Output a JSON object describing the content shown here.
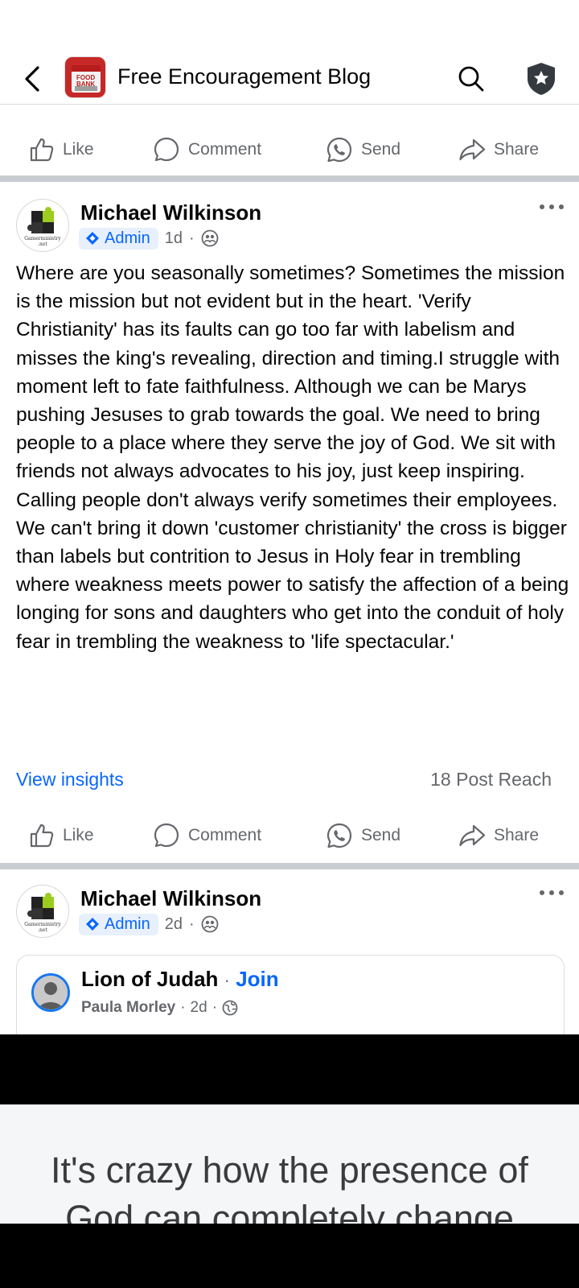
{
  "header": {
    "title": "Free Encouragement Blog",
    "thumb_text_top": "FOOD",
    "thumb_text_bottom": "BANK"
  },
  "actions": {
    "like": "Like",
    "comment": "Comment",
    "send": "Send",
    "share": "Share"
  },
  "post1": {
    "author": "Michael Wilkinson",
    "role": "Admin",
    "time": "1d",
    "avatar_caption_1": "Gamerministry",
    "avatar_caption_2": ".net",
    "body": "Where are you seasonally sometimes? Sometimes the mission is the mission but not evident but in the heart. 'Verify Christianity' has its faults can go too far with labelism and misses the king's revealing, direction and timing.I struggle with moment left to fate faithfulness. Although we can be Marys pushing Jesuses to grab towards the goal. We need to bring people to a place where they serve the joy of God. We sit with friends not always advocates to his joy, just keep inspiring. Calling people don't always verify sometimes their employees. We can't bring it down 'customer christianity' the cross is bigger than labels but contrition to Jesus in Holy fear in trembling where weakness meets power to satisfy the affection of a being longing for sons and daughters who get into the conduit of holy fear in trembling the weakness to 'life spectacular.'",
    "insights_label": "View insights",
    "reach": "18 Post Reach"
  },
  "post2": {
    "author": "Michael Wilkinson",
    "role": "Admin",
    "time": "2d",
    "avatar_caption_1": "Gamerministry",
    "avatar_caption_2": ".net",
    "shared": {
      "group": "Lion of Judah",
      "separator": "·",
      "join": "Join",
      "poster": "Paula Morley",
      "time": "2d"
    },
    "image_text_line1": "It's crazy how the presence of",
    "image_text_line2": "God can completely change"
  },
  "colors": {
    "accent": "#0866ff",
    "secondary_text": "#65676b",
    "separator": "#c9ccd1"
  }
}
